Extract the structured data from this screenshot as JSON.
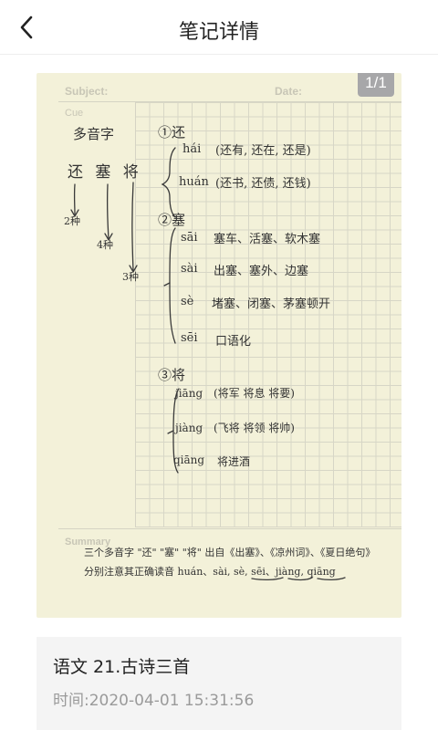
{
  "header": {
    "title": "笔记详情"
  },
  "note_page": {
    "badge": "1/1",
    "form": {
      "subject": "Subject:",
      "date": "Date:",
      "cue": "Cue",
      "summary": "Summary"
    },
    "cue_column": {
      "heading": "多音字",
      "chars": "还 塞 将",
      "counts": [
        "2种",
        "4种",
        "3种"
      ]
    },
    "sections": [
      {
        "header": "①还",
        "readings": [
          {
            "pinyin": "hái",
            "examples": "(还有, 还在, 还是)"
          },
          {
            "pinyin": "huán",
            "examples": "(还书, 还债, 还钱)"
          }
        ]
      },
      {
        "header": "②塞",
        "readings": [
          {
            "pinyin": "sāi",
            "examples": "塞车、活塞、软木塞"
          },
          {
            "pinyin": "sài",
            "examples": "出塞、塞外、边塞"
          },
          {
            "pinyin": "sè",
            "examples": "堵塞、闭塞、茅塞顿开"
          },
          {
            "pinyin": "sēi",
            "examples": "口语化"
          }
        ]
      },
      {
        "header": "③将",
        "readings": [
          {
            "pinyin": "jiāng",
            "examples": "(将军  将息  将要)"
          },
          {
            "pinyin": "jiàng",
            "examples": "(飞将  将领  将帅)"
          },
          {
            "pinyin": "qiāng",
            "examples": "将进酒"
          }
        ]
      }
    ],
    "summary_lines": [
      "三个多音字 \"还\" \"塞\" \"将\" 出自《出塞》、《凉州词》、《夏日绝句》",
      "分别注意其正确读音  huán、sài, sè, sēi、jiàng, qiāng"
    ]
  },
  "info": {
    "title": "语文   21.古诗三首",
    "time": "时间:2020-04-01 15:31:56"
  },
  "colors": {
    "paper": "#f3f1d9",
    "grid": "#d5d4c4",
    "ink": "#333333",
    "badge": "#a7a7a9",
    "card": "#f4f4f4"
  }
}
